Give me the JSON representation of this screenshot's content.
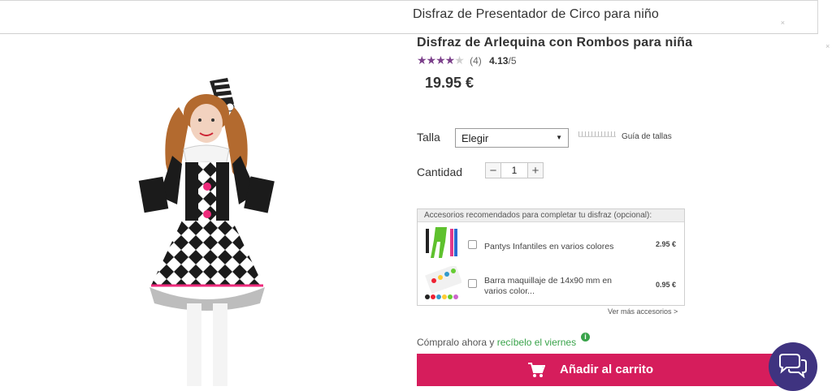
{
  "header": {
    "title": "Disfraz de Presentador de Circo para niño",
    "close_glyph": "×"
  },
  "side_close_glyph": "×",
  "product": {
    "name": "Disfraz de Arlequina con Rombos para niña",
    "rating": {
      "stars": 4,
      "max_stars": 5,
      "count": "(4)",
      "score": "4.13",
      "score_suffix": "/5"
    },
    "price": "19.95 €",
    "image_icon": "harlequin-costume-photo"
  },
  "size": {
    "label": "Talla",
    "selected": "Elegir",
    "guide_label": "Guía de tallas"
  },
  "quantity": {
    "label": "Cantidad",
    "minus": "−",
    "value": "1",
    "plus": "+"
  },
  "accessories": {
    "title": "Accesorios recomendados para completar tu disfraz (opcional):",
    "items": [
      {
        "name": "Pantys Infantiles en varios colores",
        "price": "2.95 €",
        "thumb_icon": "colored-tights-thumbnail"
      },
      {
        "name": "Barra maquillaje de 14x90 mm en varios color...",
        "price": "0.95 €",
        "thumb_icon": "makeup-sticks-thumbnail"
      }
    ],
    "more_link": "Ver más accesorios >"
  },
  "delivery": {
    "prefix": "Cómpralo ahora y ",
    "highlight": "recíbelo el viernes",
    "info_glyph": "i"
  },
  "cart": {
    "label": "Añadir al carrito",
    "icon": "shopping-cart-icon"
  },
  "chat": {
    "icon": "chat-bubbles-icon"
  },
  "colors": {
    "accent": "#d61d5c",
    "stars": "#7b3f8a",
    "delivery_green": "#39a34a",
    "chat": "#3f3380"
  }
}
